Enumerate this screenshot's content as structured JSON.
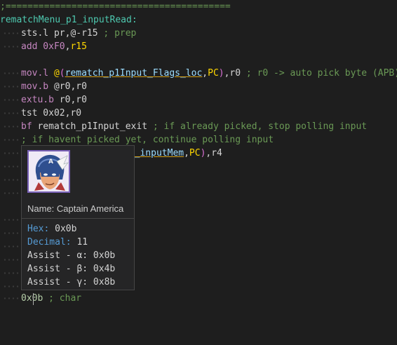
{
  "editor": {
    "divider": ";=========================================",
    "label": "rematchMenu_p1_inputRead:",
    "line1": {
      "instr": "sts.l",
      "args": " pr,@-r15",
      "comment": " ; prep"
    },
    "line2": {
      "instr": "add",
      "num": " 0xF0",
      "comma": ",",
      "reg": "r15"
    },
    "line3": {
      "instr": "mov.l",
      "at": " @",
      "paren_open": "(",
      "sym": "rematch_p1Input_Flags_loc",
      "sep": ",",
      "pc": "PC",
      "paren_close": ")",
      "rest": ",r0",
      "comment": " ; r0 -> auto pick byte (APB)"
    },
    "line4": {
      "instr": "mov.b",
      "args": " @r0,r0"
    },
    "line5": {
      "instr": "extu.b",
      "args": " r0,r0"
    },
    "line6": {
      "instr": "tst",
      "args": " 0x02,r0"
    },
    "line7": {
      "instr": "bf",
      "args": " rematch_p1Input_exit",
      "comment": " ; if already picked, stop polling input"
    },
    "line8": {
      "comment": "; if havent picked yet, continue polling input"
    },
    "line9": {
      "partial": "ut_inputMem",
      "sep": ",",
      "pc": "PC",
      "paren_close": ")",
      "rest": ",r4"
    },
    "last": {
      "value": "0x0b",
      "comment": " ; char"
    }
  },
  "hover": {
    "portrait_icon": "captain-america-portrait",
    "name": "Name: Captain America",
    "rows": [
      {
        "key": "Hex:",
        "value": " 0x0b"
      },
      {
        "key": "Decimal:",
        "value": " 11"
      },
      {
        "key": "Assist - α:",
        "value": " 0x0b"
      },
      {
        "key": "Assist - β:",
        "value": " 0x4b"
      },
      {
        "key": "Assist - γ:",
        "value": " 0x8b"
      }
    ]
  },
  "colors": {
    "background": "#1e1e1e",
    "comment": "#6a9955",
    "instruction": "#c586c0",
    "label": "#4ec9b0",
    "hover_bg": "#252526",
    "hover_key": "#569cd6"
  }
}
